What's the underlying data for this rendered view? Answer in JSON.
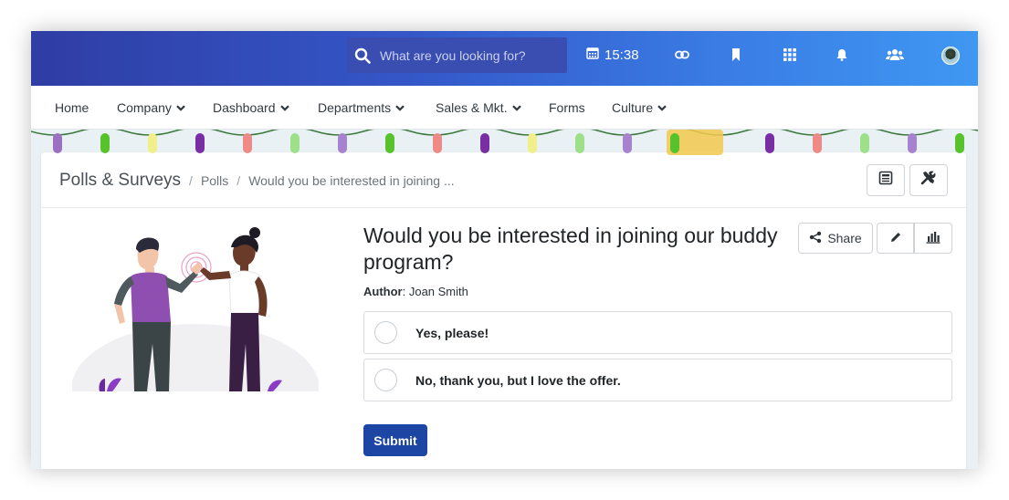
{
  "topbar": {
    "search_placeholder": "What are you looking for?",
    "time": "15:38",
    "icons": [
      "search-icon",
      "calendar-icon",
      "link-icon",
      "bookmark-icon",
      "apps-grid-icon",
      "bell-icon",
      "people-icon",
      "avatar"
    ]
  },
  "nav": {
    "items": [
      {
        "label": "Home",
        "dropdown": false
      },
      {
        "label": "Company",
        "dropdown": true
      },
      {
        "label": "Dashboard",
        "dropdown": true
      },
      {
        "label": "Departments",
        "dropdown": true
      },
      {
        "label": "Sales & Mkt.",
        "dropdown": true
      },
      {
        "label": "Forms",
        "dropdown": false
      },
      {
        "label": "Culture",
        "dropdown": true
      }
    ]
  },
  "breadcrumb": {
    "title": "Polls & Surveys",
    "items": [
      "Polls",
      "Would you be interested in joining ..."
    ]
  },
  "poll": {
    "question": "Would you be interested in joining our buddy program?",
    "author_label": "Author",
    "author_name": ": Joan Smith",
    "share_label": "Share",
    "options": [
      "Yes, please!",
      "No, thank you, but I love the offer."
    ],
    "submit_label": "Submit"
  },
  "colors": {
    "topbar_start": "#2f3da4",
    "topbar_end": "#3f98f2",
    "submit": "#1d45a3"
  }
}
